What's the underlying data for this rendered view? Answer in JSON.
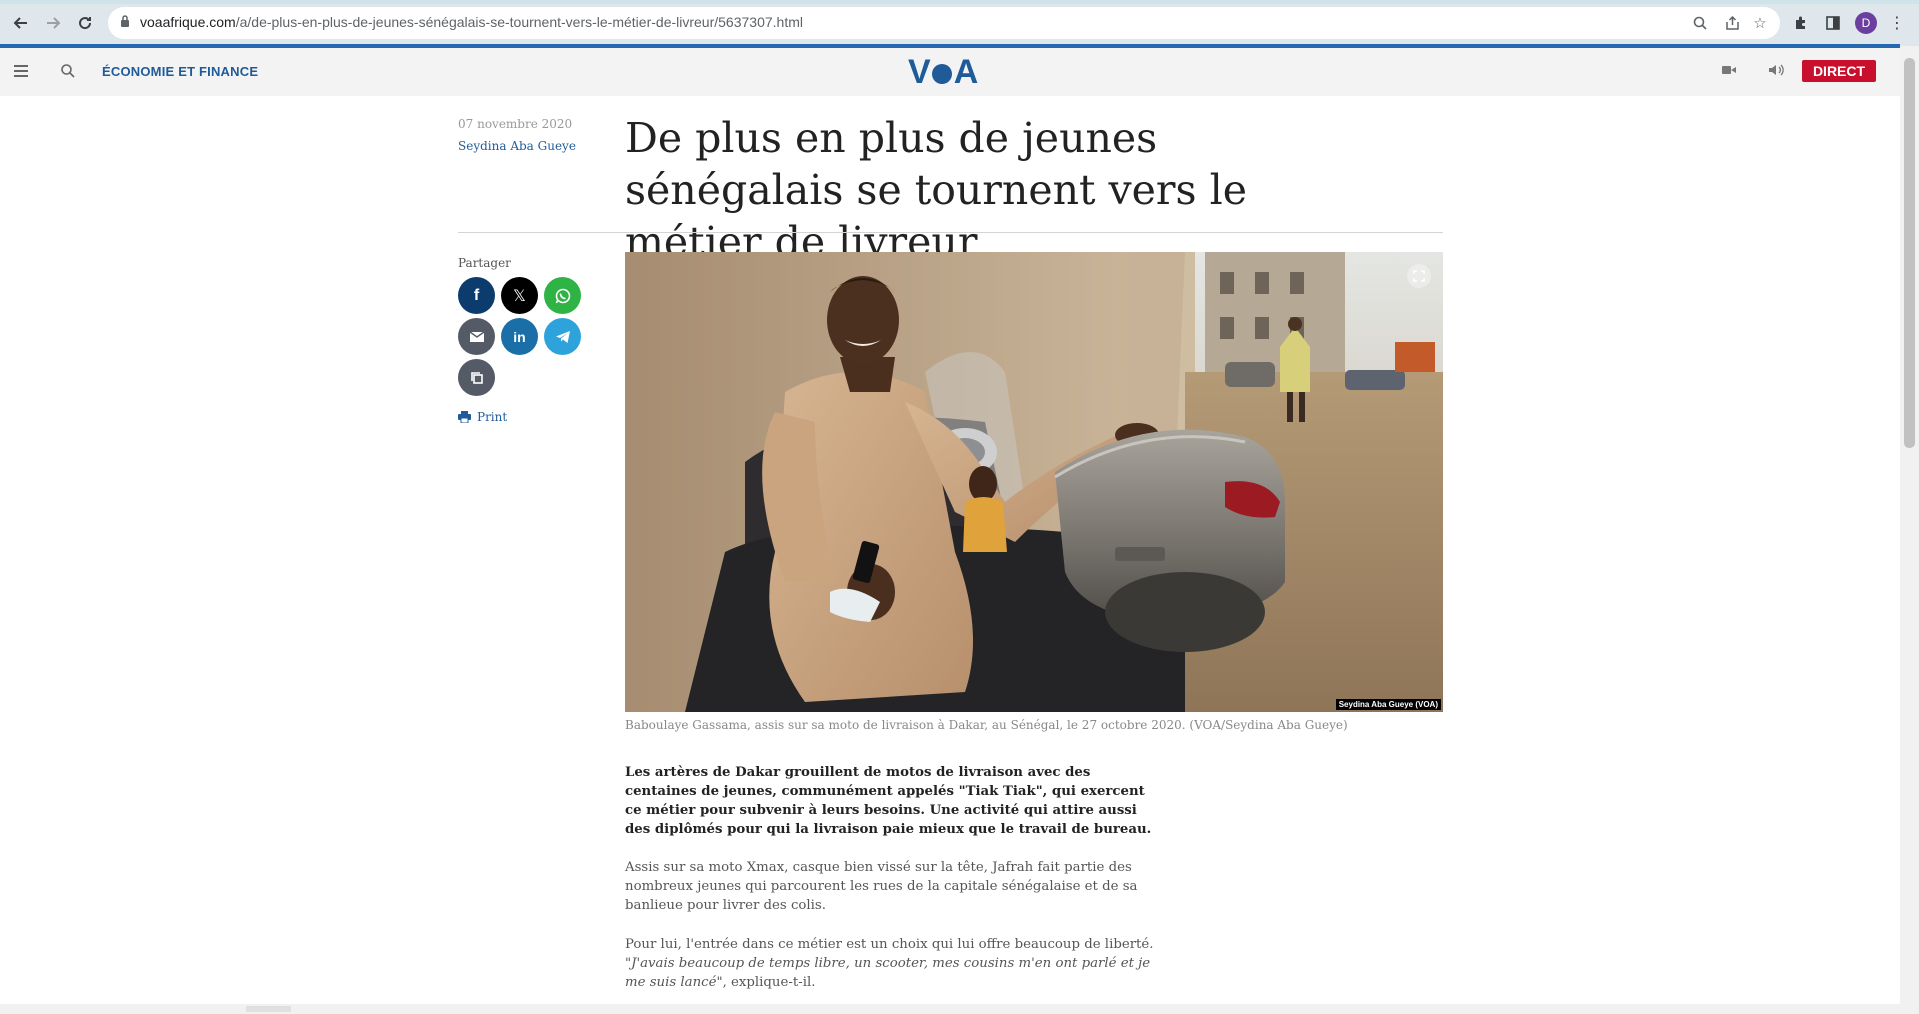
{
  "browser": {
    "url_host": "voaafrique.com",
    "url_path": "/a/de-plus-en-plus-de-jeunes-sénégalais-se-tournent-vers-le-métier-de-livreur/5637307.html",
    "profile_initial": "D",
    "icons": [
      "back-icon",
      "forward-icon",
      "reload-icon",
      "lock-icon",
      "zoom-icon",
      "share-icon",
      "star-icon",
      "extensions-icon",
      "sidepanel-icon",
      "menu-icon"
    ]
  },
  "header": {
    "section": "ÉCONOMIE ET FINANCE",
    "logo": "VOA",
    "live_label": "DIRECT",
    "brand_color": "#1f5b99",
    "live_color": "#c8102e"
  },
  "article": {
    "date": "07 novembre 2020",
    "author": "Seydina Aba Gueye",
    "title": "De plus en plus de jeunes sénégalais se tournent vers le métier de livreur",
    "share_label": "Partager",
    "print_label": "Print",
    "photo_credit": "Seydina Aba Gueye (VOA)",
    "caption": "Baboulaye Gassama, assis sur sa moto de livraison à Dakar, au Sénégal, le 27 octobre 2020. (VOA/Seydina Aba Gueye)",
    "lead": "Les artères de Dakar grouillent de motos de livraison avec des centaines de jeunes, communément appelés \"Tiak Tiak\", qui exercent ce métier pour subvenir à leurs besoins. Une activité qui attire aussi des diplômés pour qui la livraison paie mieux que le travail de bureau.",
    "p1": "Assis sur sa moto Xmax, casque bien vissé sur la tête, Jafrah fait partie des nombreux jeunes qui parcourent les rues de la capitale sénégalaise et de sa banlieue pour livrer des colis.",
    "p2_start": "Pour lui, l'entrée dans ce métier est un choix qui lui offre beaucoup de liberté.",
    "p2_quote": "\"J'avais beaucoup de temps libre, un scooter, mes cousins m'en ont parlé et je me suis lancé\"",
    "p2_end": ", explique-t-il."
  }
}
